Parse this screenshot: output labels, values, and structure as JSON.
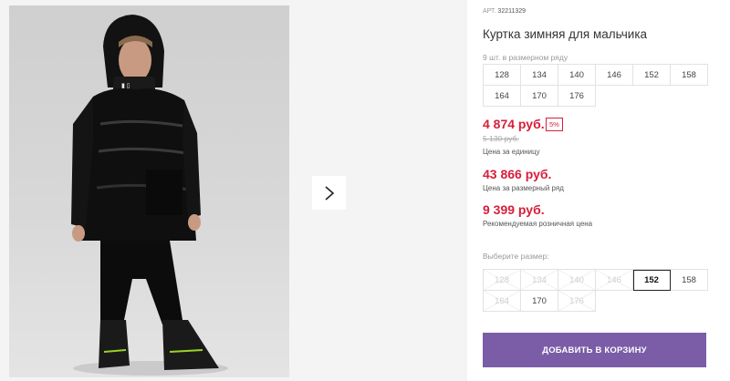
{
  "product": {
    "article_label": "АРТ.",
    "article_number": "32211329",
    "title": "Куртка зимняя для мальчика",
    "pack_info": "9 шт. в размерном ряду",
    "pack_sizes": [
      "128",
      "134",
      "140",
      "146",
      "152",
      "158",
      "164",
      "170",
      "176"
    ]
  },
  "pricing": {
    "current_price": "4 874 руб.",
    "discount_badge": "5%",
    "old_price": "5 130 руб.",
    "unit_label": "Цена за единицу",
    "row_price": "43 866 руб.",
    "row_label": "Цена за размерный ряд",
    "retail_price": "9 399 руб.",
    "retail_label": "Рекомендуемая розничная цена"
  },
  "size_selector": {
    "label": "Выберите размер:",
    "options": [
      {
        "size": "128",
        "available": false
      },
      {
        "size": "134",
        "available": false
      },
      {
        "size": "140",
        "available": false
      },
      {
        "size": "146",
        "available": false
      },
      {
        "size": "152",
        "available": true,
        "selected": true
      },
      {
        "size": "158",
        "available": true
      },
      {
        "size": "164",
        "available": false
      },
      {
        "size": "170",
        "available": true
      },
      {
        "size": "176",
        "available": false
      }
    ]
  },
  "actions": {
    "add_to_cart": "ДОБАВИТЬ В КОРЗИНУ"
  },
  "gallery": {
    "next_icon": "chevron-right-icon"
  },
  "colors": {
    "price_red": "#d81e3a",
    "button_purple": "#7a5ca7",
    "jacket_black": "#111111"
  }
}
